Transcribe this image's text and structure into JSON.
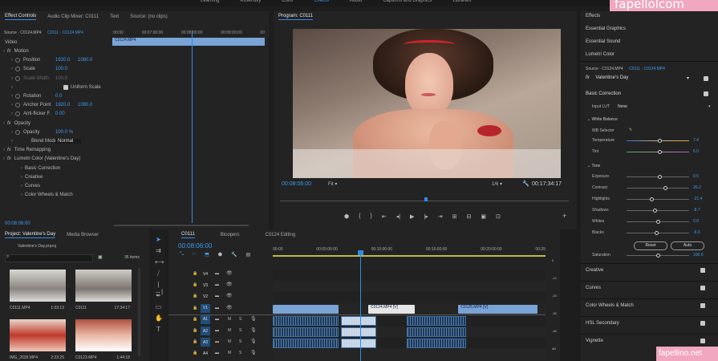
{
  "workspaces": [
    "Learning",
    "Assembly",
    "Color",
    "Effects",
    "Audio",
    "Captions and Graphics",
    "Libraries"
  ],
  "active_workspace": "Effects",
  "watermark_top": "fapellolcom",
  "watermark_bottom": "fapellino.net",
  "effect_controls": {
    "tabs": [
      "Effect Controls",
      "Audio Clip Mixer: C0111",
      "Text",
      "Source: (no clips)"
    ],
    "source_label": "Source · C0124.MP4",
    "sequence_label": "C0111 · C0124.MP4",
    "ruler": [
      ":00:00",
      "00:07:00:00",
      "00:08:00:00",
      "00:09:00:00",
      "00"
    ],
    "clip_name": "C0124.MP4",
    "video_label": "Video",
    "rows": [
      {
        "name": "Motion",
        "kind": "fx"
      },
      {
        "name": "Position",
        "v1": "1920.0",
        "v2": "1080.0"
      },
      {
        "name": "Scale",
        "v1": "100.0"
      },
      {
        "name": "Scale Width",
        "v1": "100.0",
        "dim": true
      },
      {
        "name": "Uniform Scale"
      },
      {
        "name": "Rotation",
        "v1": "0.0"
      },
      {
        "name": "Anchor Point",
        "v1": "1920.0",
        "v2": "1080.0"
      },
      {
        "name": "Anti-flicker F.",
        "v1": "0.00"
      },
      {
        "name": "Opacity",
        "kind": "fx"
      },
      {
        "name": "Opacity",
        "v1": "100.0 %"
      },
      {
        "name": "Blend Mode",
        "v1": "Normal"
      },
      {
        "name": "Time Remapping",
        "kind": "fx"
      },
      {
        "name": "Lumetri Color (Valentine's Day)",
        "kind": "fx"
      },
      {
        "name": "Basic Correction"
      },
      {
        "name": "Creative"
      },
      {
        "name": "Curves"
      },
      {
        "name": "Color Wheels & Match"
      }
    ],
    "timecode": "00:08:06:00"
  },
  "program": {
    "title": "Program: C0111",
    "timecode": "00:08:06:00",
    "fit": "Fit",
    "quality": "1/6",
    "duration": "00:17:34:17"
  },
  "project": {
    "tabs": [
      "Project: Valentine's Day",
      "Media Browser"
    ],
    "file": "Valentine's Day.prproj",
    "items_count": "36 items",
    "clips": [
      {
        "name": "C0111.MP4",
        "dur": "1:03:13"
      },
      {
        "name": "C0111",
        "dur": "17:34:17"
      },
      {
        "name": "IMG_2039.MP4",
        "dur": "2:23:25"
      },
      {
        "name": "C0123.MP4",
        "dur": "1:44:18"
      }
    ]
  },
  "timeline": {
    "tabs": [
      "C0111",
      "Bloopers",
      "C0124 Editing"
    ],
    "timecode": "00:08:06:00",
    "ruler": [
      "00:00",
      "00:05:00:00",
      "00:10:00:00",
      "00:15:00:00",
      "00:20:00:00",
      "00:25"
    ],
    "tracks": [
      "V4",
      "V3",
      "V2",
      "V1",
      "A1",
      "A2",
      "A3",
      "A4"
    ],
    "clips": [
      {
        "name": "C0124.MP4 [V]",
        "track": "V1",
        "start": 0.35,
        "end": 0.52
      },
      {
        "name": "C0125.MP4 [V]",
        "track": "V1",
        "start": 0.68,
        "end": 0.97
      }
    ],
    "db": [
      "0",
      "-12",
      "-24",
      "-36",
      "-48",
      "dB"
    ]
  },
  "lumetri": {
    "panels": [
      "Effects",
      "Essential Graphics",
      "Essential Sound",
      "Lumetri Color"
    ],
    "source": "Source · C0124.MP4",
    "sequence": "C0111 · C0124.MP4",
    "preset": "Valentine's Day",
    "basic": "Basic Correction",
    "input_lut_label": "Input LUT",
    "input_lut": "None",
    "wb": "White Balance",
    "wb_selector": "WB Selector",
    "sliders_wb": [
      {
        "label": "Temperature",
        "value": "7.4",
        "pos": 0.53
      },
      {
        "label": "Tint",
        "value": "6.0",
        "pos": 0.52
      }
    ],
    "tone": "Tone",
    "sliders_tone": [
      {
        "label": "Exposure",
        "value": "0.5",
        "pos": 0.52
      },
      {
        "label": "Contrast",
        "value": "26.2",
        "pos": 0.62
      },
      {
        "label": "Highlights",
        "value": "-21.4",
        "pos": 0.4
      },
      {
        "label": "Shadows",
        "value": "-8.7",
        "pos": 0.45
      },
      {
        "label": "Whites",
        "value": "0.0",
        "pos": 0.5
      },
      {
        "label": "Blacks",
        "value": "-6.0",
        "pos": 0.47
      }
    ],
    "reset": "Reset",
    "auto": "Auto",
    "saturation": {
      "label": "Saturation",
      "value": "100.0",
      "pos": 0.5
    },
    "sections": [
      "Creative",
      "Curves",
      "Color Wheels & Match",
      "HSL Secondary",
      "Vignette"
    ],
    "colors": {
      "accent": "#2d8ceb",
      "value": "#3d9cf0",
      "panel": "#232323"
    }
  }
}
